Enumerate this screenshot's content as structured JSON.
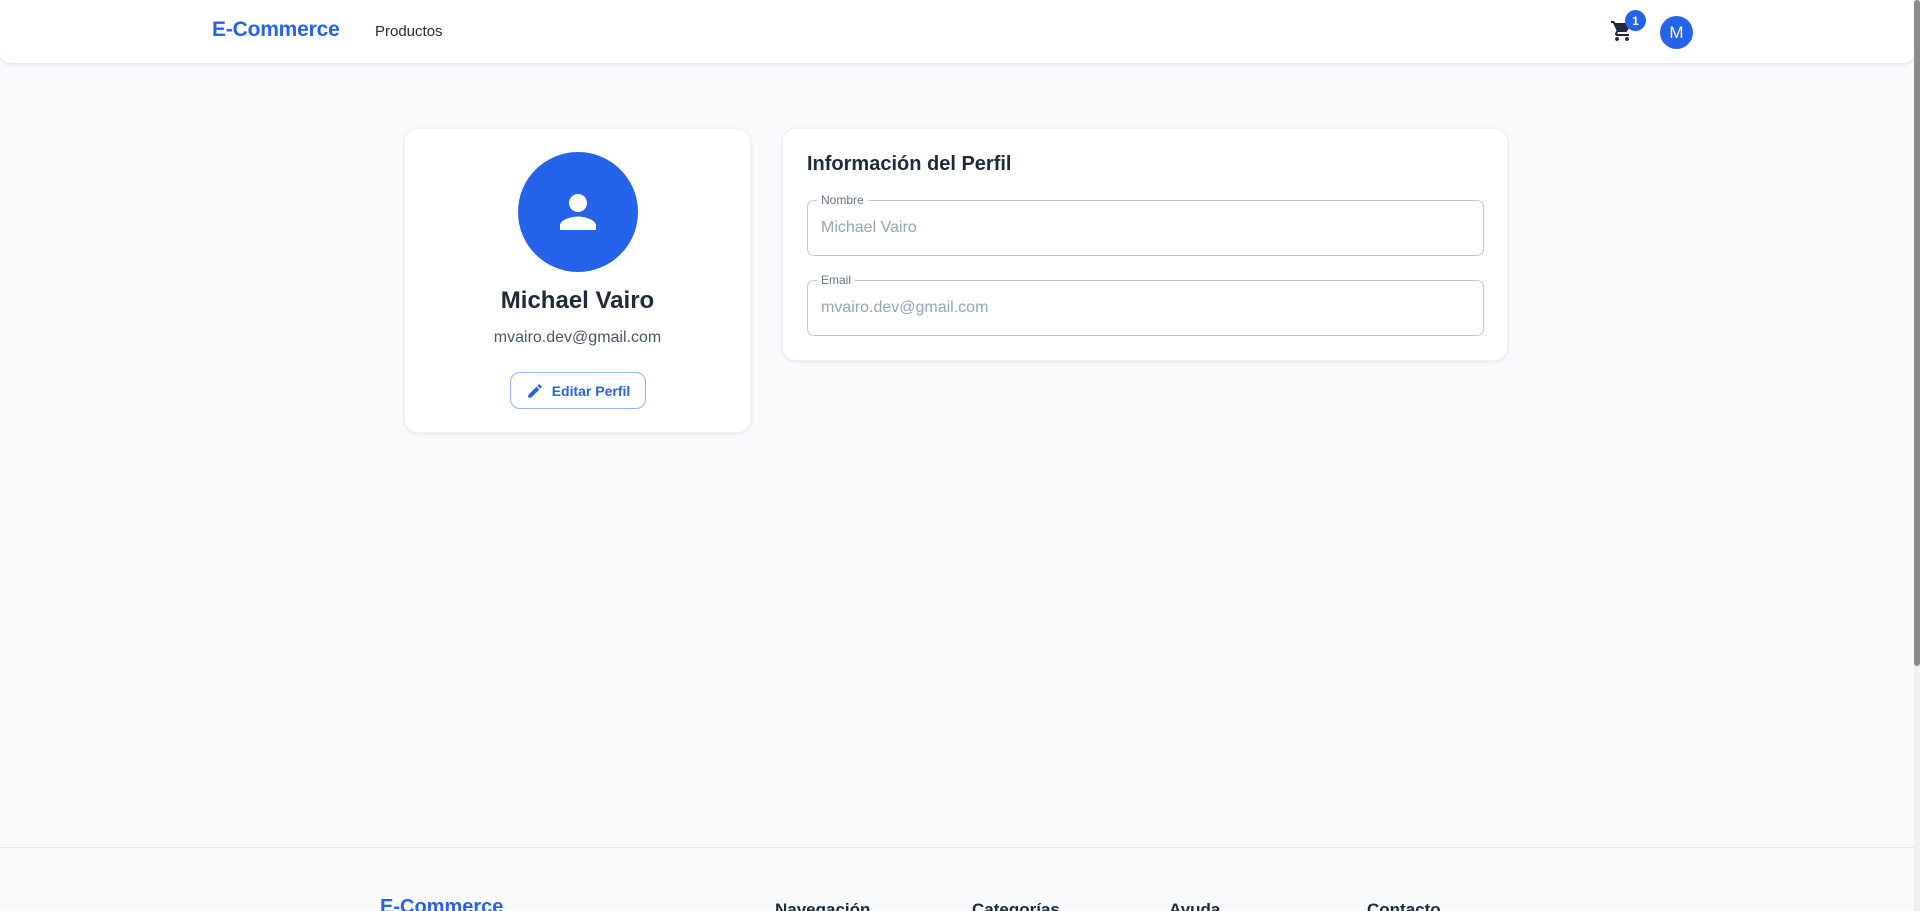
{
  "header": {
    "brand": "E-Commerce",
    "nav": {
      "products": "Productos"
    },
    "cart": {
      "icon": "cart-icon",
      "count": "1"
    },
    "avatar_initial": "M"
  },
  "profile": {
    "avatar_icon": "person-icon",
    "name": "Michael Vairo",
    "email": "mvairo.dev@gmail.com",
    "edit_button": {
      "icon": "pencil-icon",
      "label": "Editar Perfil"
    }
  },
  "info": {
    "title": "Información del Perfil",
    "fields": {
      "name": {
        "label": "Nombre",
        "value": "Michael Vairo"
      },
      "email": {
        "label": "Email",
        "value": "mvairo.dev@gmail.com"
      }
    }
  },
  "footer": {
    "brand": "E-Commerce",
    "columns": [
      "Navegación",
      "Categorías",
      "Ayuda",
      "Contacto"
    ]
  },
  "colors": {
    "accent": "#2563eb",
    "background": "#f8fafc",
    "card": "#ffffff",
    "text": "#1e293b"
  }
}
